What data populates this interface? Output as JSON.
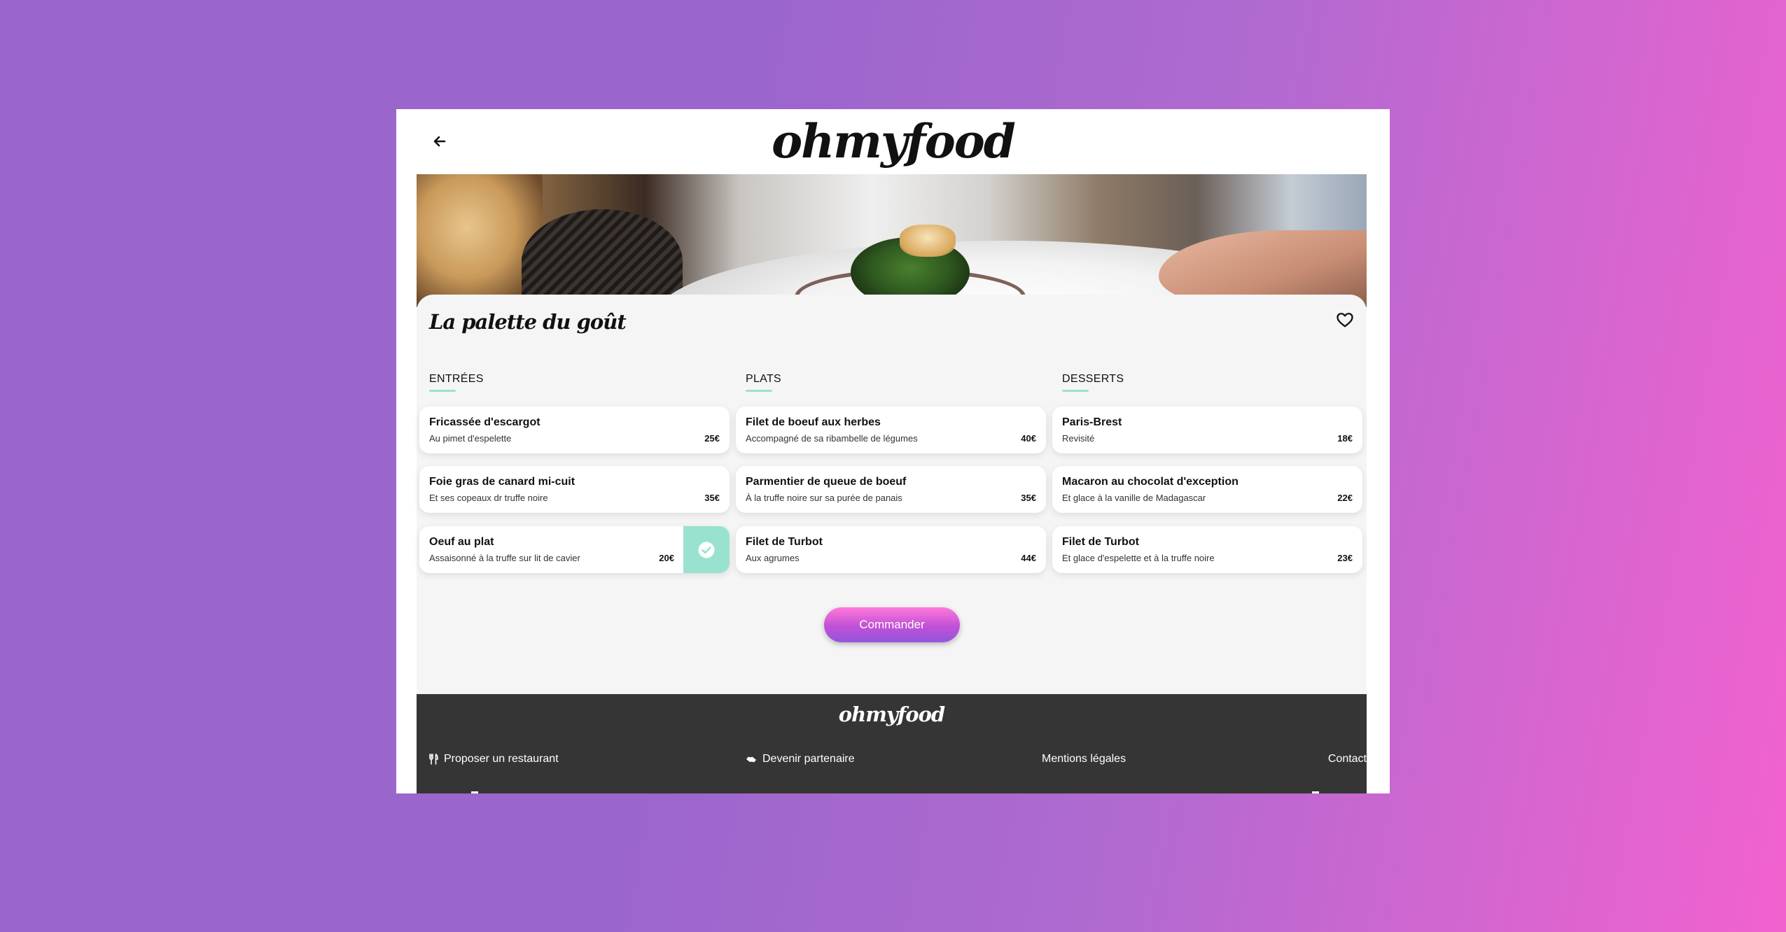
{
  "header": {
    "brand": "ohmyfood"
  },
  "restaurant": {
    "name": "La palette du goût"
  },
  "menu": {
    "columns": [
      {
        "title": "ENTRÉES",
        "dishes": [
          {
            "name": "Fricassée d'escargot",
            "desc": "Au pimet d'espelette",
            "price": "25€",
            "selected": false
          },
          {
            "name": "Foie gras de canard mi-cuit",
            "desc": "Et ses copeaux dr truffe noire",
            "price": "35€",
            "selected": false
          },
          {
            "name": "Oeuf au plat",
            "desc": "Assaisonné à la truffe sur lit de cavier",
            "price": "20€",
            "selected": true
          }
        ]
      },
      {
        "title": "PLATS",
        "dishes": [
          {
            "name": "Filet de boeuf aux herbes",
            "desc": "Accompagné de sa ribambelle de légumes",
            "price": "40€",
            "selected": false
          },
          {
            "name": "Parmentier de queue de boeuf",
            "desc": "À la truffe noire sur sa purée de panais",
            "price": "35€",
            "selected": false
          },
          {
            "name": "Filet de Turbot",
            "desc": "Aux agrumes",
            "price": "44€",
            "selected": false
          }
        ]
      },
      {
        "title": "DESSERTS",
        "dishes": [
          {
            "name": "Paris-Brest",
            "desc": "Revisité",
            "price": "18€",
            "selected": false
          },
          {
            "name": "Macaron au chocolat d'exception",
            "desc": "Et glace à la vanille de Madagascar",
            "price": "22€",
            "selected": false
          },
          {
            "name": "Filet de Turbot",
            "desc": "Et glace d'espelette et à la truffe noire",
            "price": "23€",
            "selected": false
          }
        ]
      }
    ]
  },
  "order_button": {
    "label": "Commander"
  },
  "footer": {
    "brand": "ohmyfood",
    "links": {
      "propose": "Proposer un restaurant",
      "partner": "Devenir partenaire",
      "legal": "Mentions légales",
      "contact": "Contact"
    }
  },
  "icons": {
    "back": "arrow-left-icon",
    "favorite": "heart-outline-icon",
    "selected": "check-circle-icon",
    "propose": "utensils-icon",
    "partner": "handshake-icon"
  },
  "colors": {
    "accent_mint": "#99e2d0",
    "button_top": "#ff79da",
    "button_bottom": "#9356dc",
    "footer_bg": "#353535",
    "card_bg": "#f5f5f5"
  }
}
